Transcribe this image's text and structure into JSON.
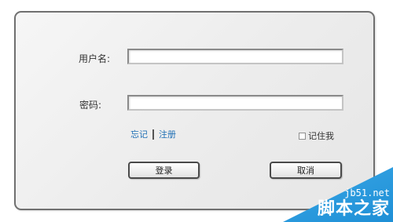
{
  "form": {
    "username_label": "用户名:",
    "username_value": "",
    "password_label": "密码:",
    "password_value": "",
    "forgot_link": "忘记",
    "register_link": "注册",
    "remember_label": "记住我",
    "remember_checked": false,
    "login_button": "登录",
    "cancel_button": "取消"
  },
  "watermark": {
    "url": "jb51.net",
    "brand": "脚本之家"
  },
  "colors": {
    "link": "#1f6fb5",
    "watermark": "#2b9de0"
  }
}
